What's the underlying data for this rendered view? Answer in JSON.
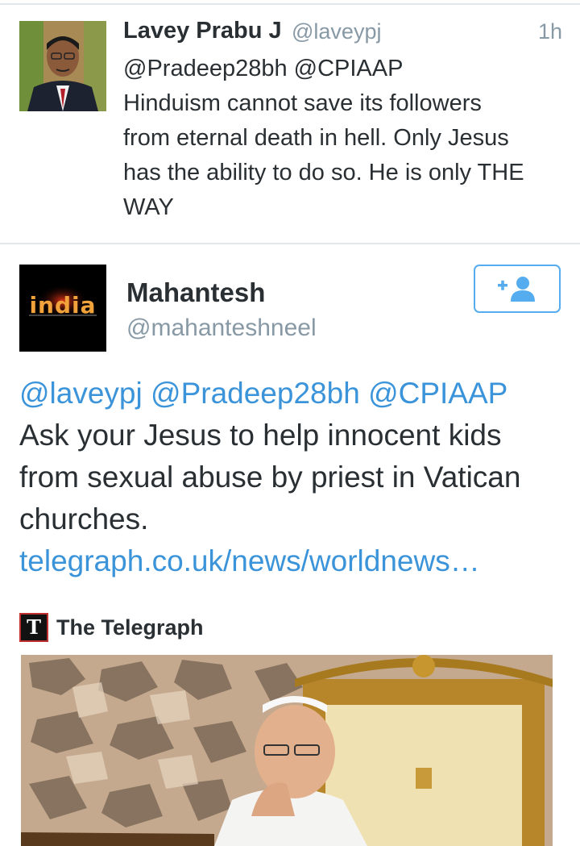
{
  "reply_tweet": {
    "name": "Lavey Prabu J",
    "handle": "@laveypj",
    "time": "1h",
    "text_lines": [
      "@Pradeep28bh @CPIAAP",
      "Hinduism cannot save its followers",
      "from eternal death in hell. Only Jesus",
      "has the ability to do so. He is only THE",
      "WAY"
    ]
  },
  "main_tweet": {
    "name": "Mahantesh",
    "handle": "@mahanteshneel",
    "avatar_text": "india",
    "mentions": [
      "@laveypj",
      "@Pradeep28bh",
      "@CPIAAP"
    ],
    "body_lines": [
      "Ask your Jesus to help innocent kids",
      "from sexual abuse by priest in Vatican",
      "churches."
    ],
    "link": "telegraph.co.uk/news/worldnews…"
  },
  "card": {
    "source_icon_letter": "T",
    "source_name": "The Telegraph"
  },
  "colors": {
    "link": "#3b94d9",
    "secondary_text": "#8899a6",
    "primary_text": "#292f33",
    "divider": "#e1e8ed"
  },
  "icons": {
    "follow": "add-user-icon"
  }
}
